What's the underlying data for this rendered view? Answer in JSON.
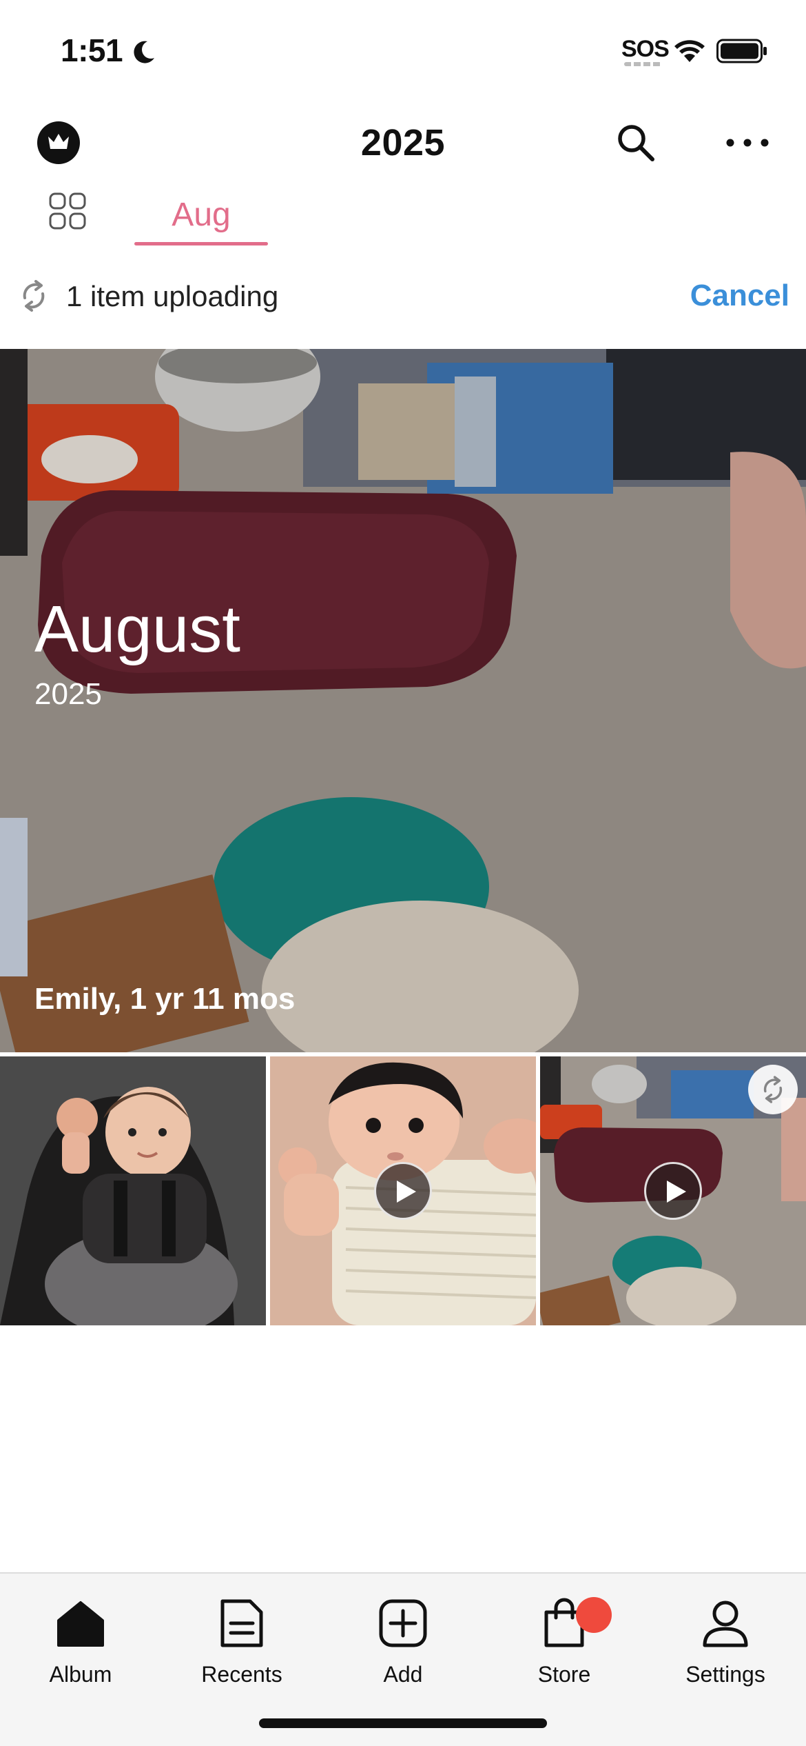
{
  "status_bar": {
    "time": "1:51",
    "carrier": "SOS"
  },
  "header": {
    "title": "2025"
  },
  "tabs": {
    "active_month": "Aug"
  },
  "upload": {
    "text": "1 item uploading",
    "cancel_label": "Cancel"
  },
  "hero": {
    "month": "August",
    "year": "2025",
    "caption": "Emily, 1 yr 11 mos"
  },
  "thumbnails": [
    {
      "kind": "photo"
    },
    {
      "kind": "video"
    },
    {
      "kind": "video",
      "uploading": true
    }
  ],
  "tab_bar": {
    "items": [
      {
        "label": "Album",
        "icon": "home-icon"
      },
      {
        "label": "Recents",
        "icon": "document-icon"
      },
      {
        "label": "Add",
        "icon": "plus-square-icon"
      },
      {
        "label": "Store",
        "icon": "shopping-bag-icon",
        "badge": true
      },
      {
        "label": "Settings",
        "icon": "person-icon"
      }
    ]
  },
  "colors": {
    "accent_pink": "#e26d8a",
    "link_blue": "#3b8fd9",
    "badge_red": "#ef4a3d"
  }
}
